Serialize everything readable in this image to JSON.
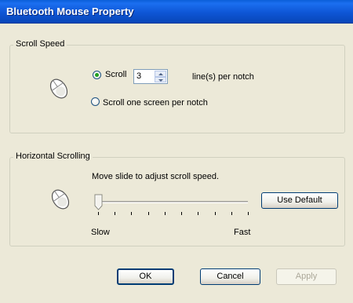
{
  "window": {
    "title": "Bluetooth Mouse Property"
  },
  "scroll_speed": {
    "legend": "Scroll Speed",
    "radio_scroll_label": "Scroll",
    "radio_scroll_checked": true,
    "lines_value": "3",
    "lines_suffix": "line(s) per notch",
    "radio_screen_label": "Scroll one screen per notch",
    "radio_screen_checked": false
  },
  "horizontal_scrolling": {
    "legend": "Horizontal Scrolling",
    "instruction": "Move slide to adjust scroll speed.",
    "use_default_label": "Use Default",
    "slow_label": "Slow",
    "fast_label": "Fast",
    "slider_level": 0,
    "tick_count": 10
  },
  "buttons": {
    "ok_label": "OK",
    "cancel_label": "Cancel",
    "apply_label": "Apply",
    "apply_enabled": false
  },
  "icons": {
    "mouse": "mouse-icon"
  },
  "colors": {
    "titlebar": "#0a5fd8",
    "dialog_bg": "#ece9d8",
    "radio_dot": "#21a121"
  }
}
